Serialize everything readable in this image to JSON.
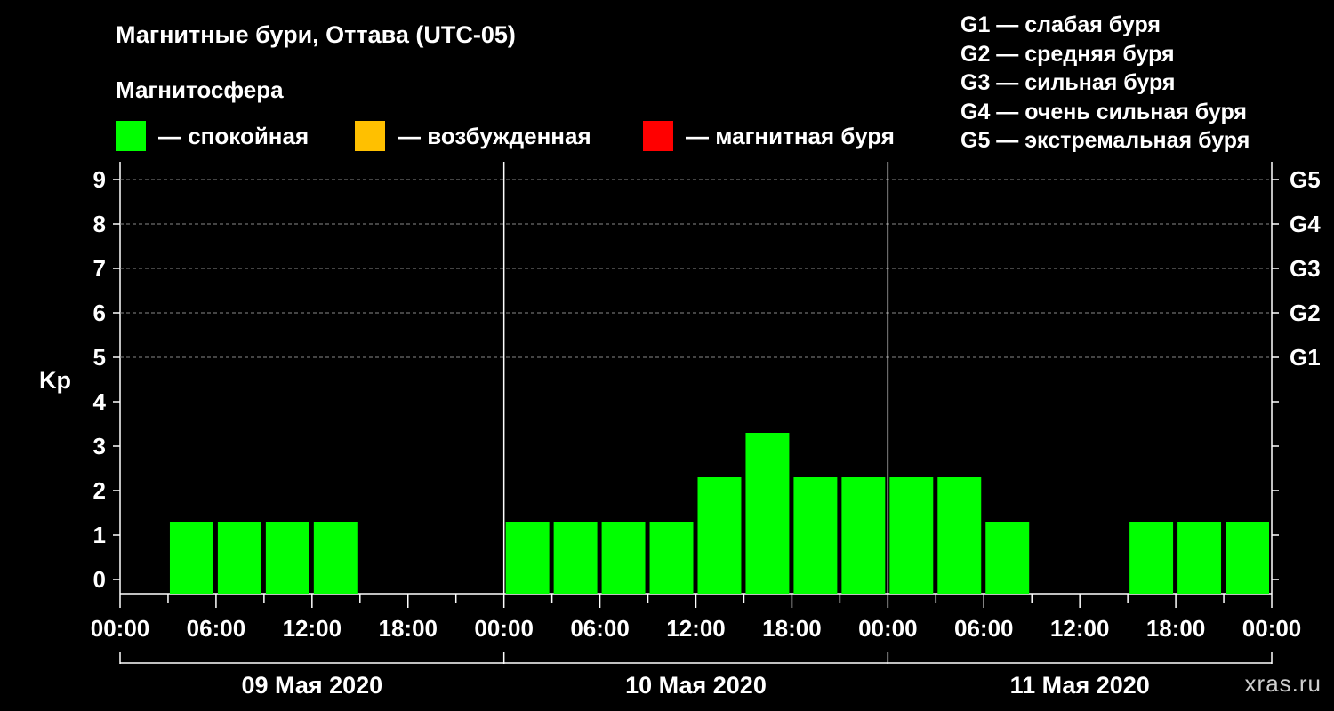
{
  "header": {
    "title": "Магнитные бури, Оттава (UTC-05)",
    "subtitle": "Магнитосфера"
  },
  "legend": [
    {
      "label": "— спокойная",
      "color": "#00ff00"
    },
    {
      "label": "— возбужденная",
      "color": "#ffc000"
    },
    {
      "label": "— магнитная буря",
      "color": "#ff0000"
    }
  ],
  "storm_scale": [
    "G1 — слабая буря",
    "G2 — средняя буря",
    "G3 — сильная буря",
    "G4 — очень сильная буря",
    "G5 — экстремальная буря"
  ],
  "watermark": "xras.ru",
  "chart_data": {
    "type": "bar",
    "ylabel": "Kp",
    "ylim": [
      0,
      9
    ],
    "y_ticks": [
      0,
      1,
      2,
      3,
      4,
      5,
      6,
      7,
      8,
      9
    ],
    "right_ticks": [
      {
        "kp": 5,
        "label": "G1"
      },
      {
        "kp": 6,
        "label": "G2"
      },
      {
        "kp": 7,
        "label": "G3"
      },
      {
        "kp": 8,
        "label": "G4"
      },
      {
        "kp": 9,
        "label": "G5"
      }
    ],
    "grid": "dashed horizontal at Kp 5–9",
    "x_tick_labels": [
      "00:00",
      "06:00",
      "12:00",
      "18:00",
      "00:00",
      "06:00",
      "12:00",
      "18:00",
      "00:00",
      "06:00",
      "12:00",
      "18:00",
      "00:00"
    ],
    "days": [
      "09 Мая 2020",
      "10 Мая 2020",
      "11 Мая 2020"
    ],
    "interval_hours": 3,
    "values": [
      null,
      1,
      1,
      1,
      1,
      null,
      null,
      null,
      1,
      1,
      1,
      1,
      2,
      3,
      2,
      2,
      2,
      2,
      1,
      null,
      null,
      1,
      1,
      1
    ],
    "colors": {
      "calm": "#00ff00",
      "active": "#ffc000",
      "storm": "#ff0000"
    }
  }
}
